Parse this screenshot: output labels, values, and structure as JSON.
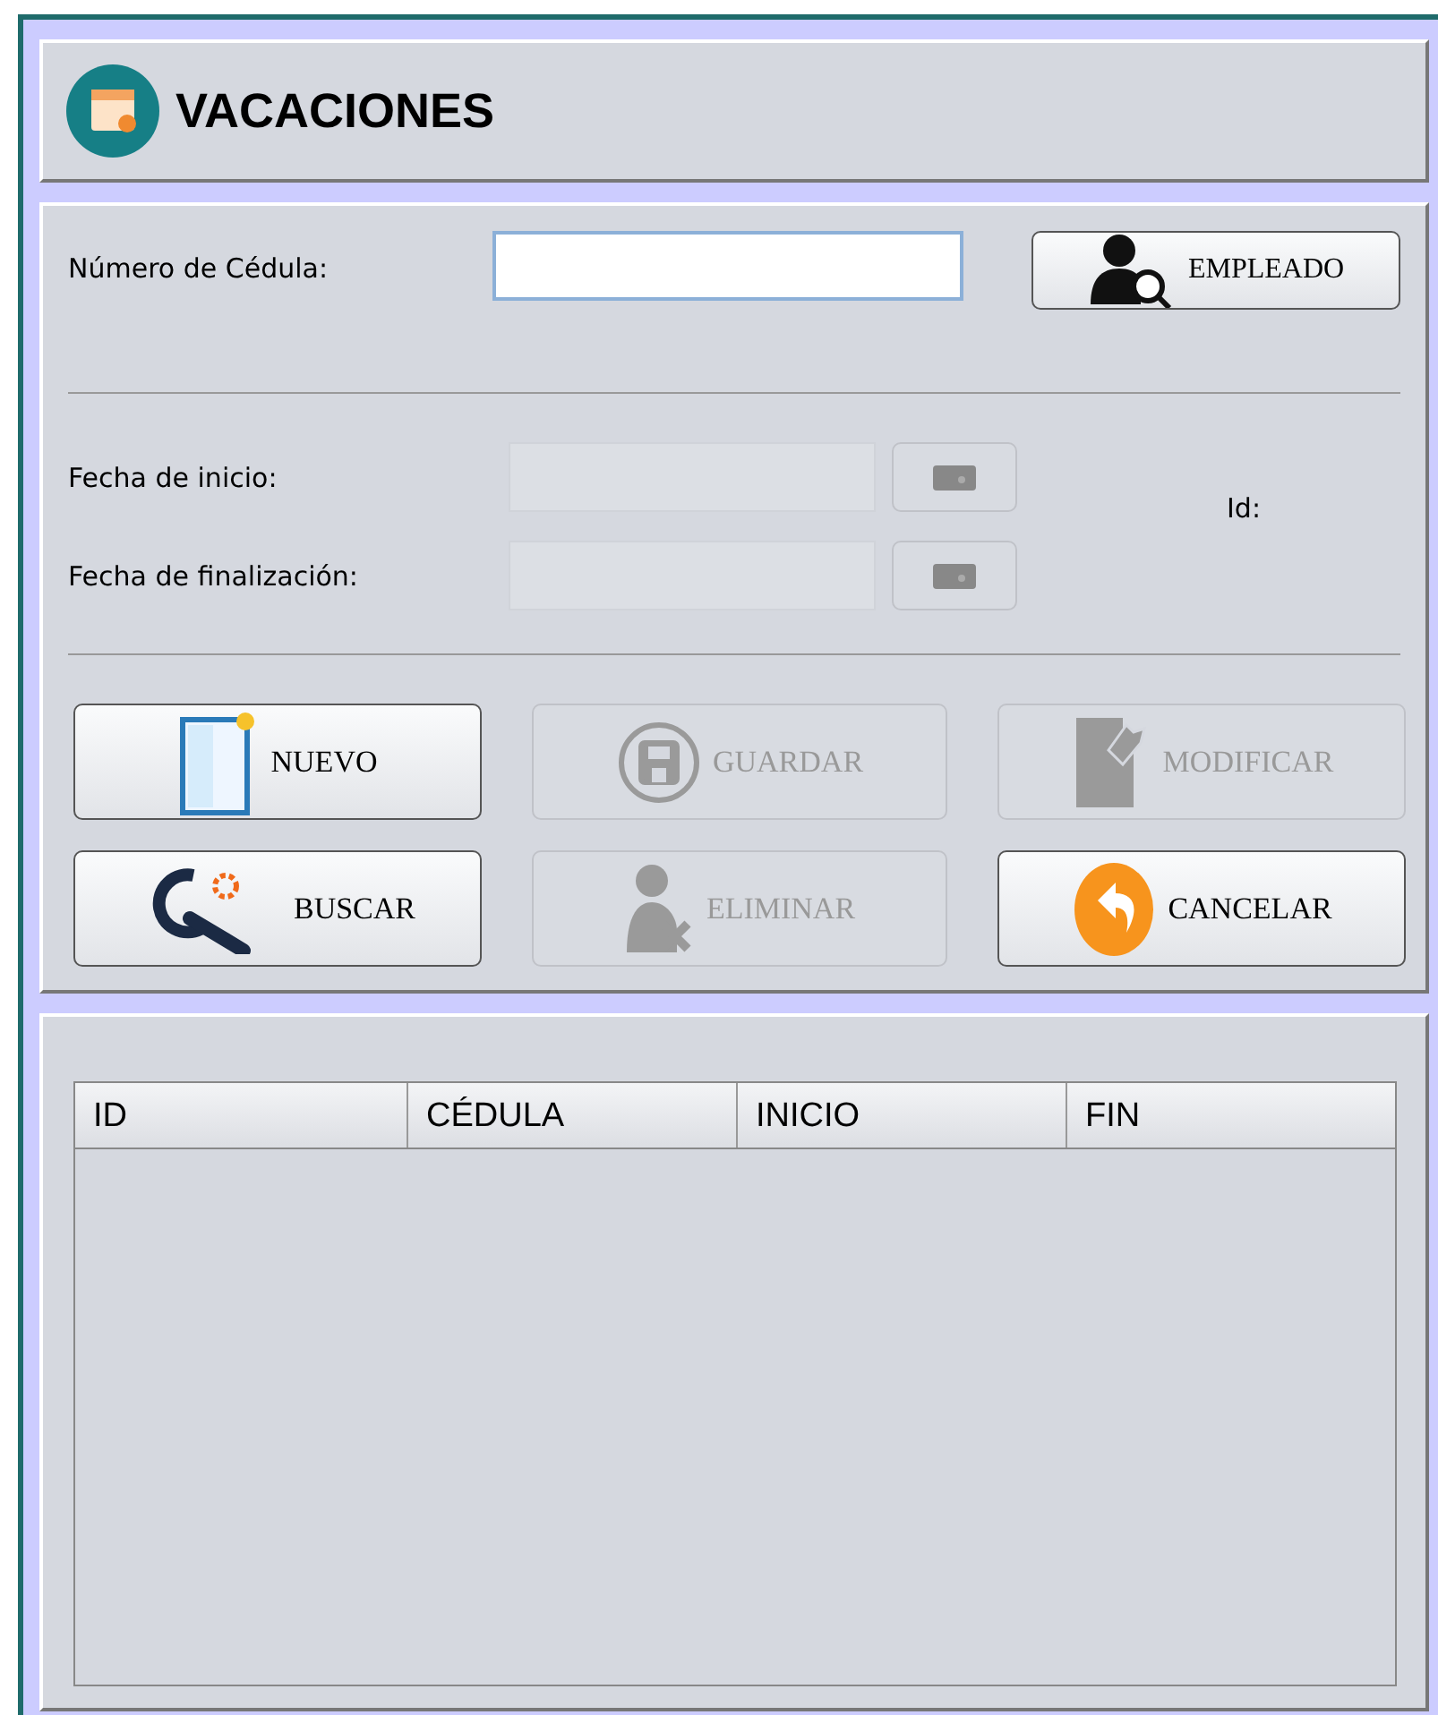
{
  "header": {
    "title": "VACACIONES"
  },
  "cedula": {
    "label": "Número de Cédula:",
    "button": "EMPLEADO"
  },
  "dates": [
    {
      "label": "Fecha de inicio:",
      "disabled": true
    },
    {
      "label": "Fecha de finalización:",
      "disabled": true
    }
  ],
  "id_label": "Id:",
  "actions": [
    {
      "label": "NUEVO",
      "kind": "new",
      "disabled": false
    },
    {
      "label": "GUARDAR",
      "kind": "save",
      "disabled": true
    },
    {
      "label": "MODIFICAR",
      "kind": "edit",
      "disabled": true
    },
    {
      "label": "BUSCAR",
      "kind": "search",
      "disabled": false
    },
    {
      "label": "ELIMINAR",
      "kind": "delete",
      "disabled": true
    },
    {
      "label": "CANCELAR",
      "kind": "cancel",
      "disabled": false
    }
  ],
  "table": {
    "columns": [
      "ID",
      "CÉDULA",
      "INICIO",
      "FIN"
    ]
  }
}
